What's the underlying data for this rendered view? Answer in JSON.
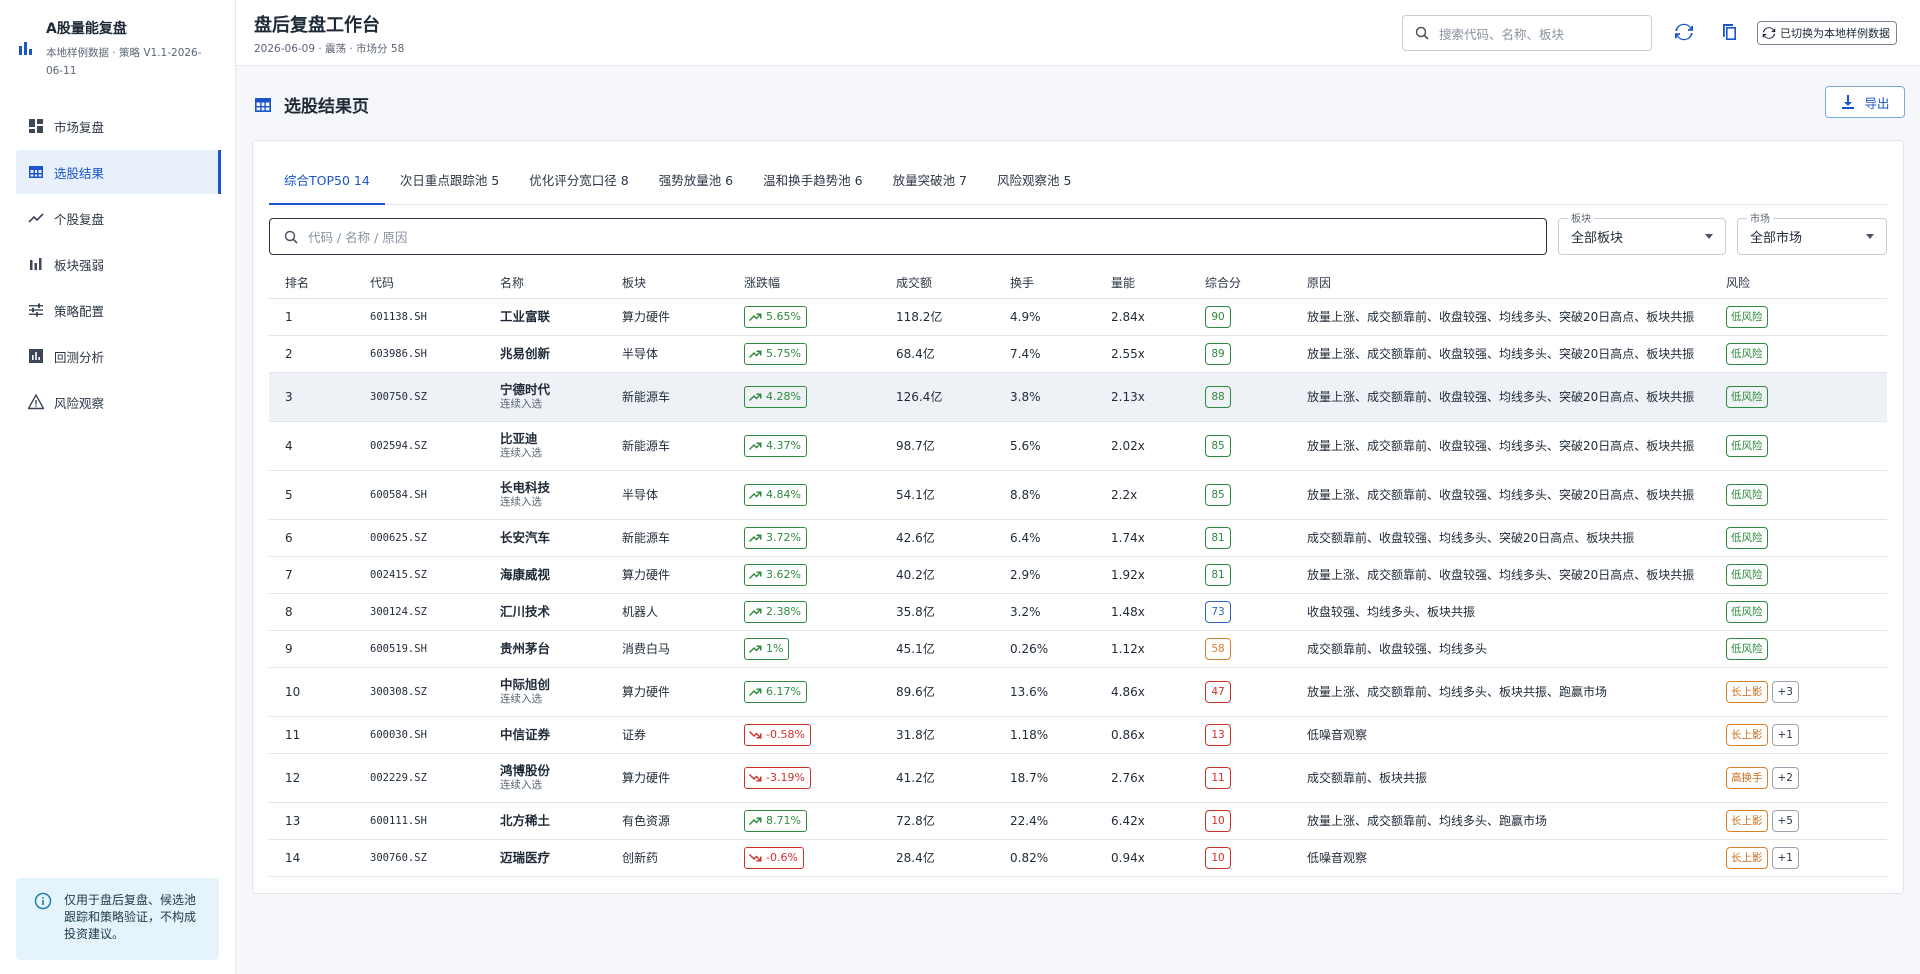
{
  "brand": {
    "title": "A股量能复盘",
    "subtitle": "本地样例数据 · 策略 V1.1-2026-06-11"
  },
  "sidebar": {
    "items": [
      {
        "label": "市场复盘",
        "icon": "dashboard-icon"
      },
      {
        "label": "选股结果",
        "icon": "table-icon",
        "active": true
      },
      {
        "label": "个股复盘",
        "icon": "trend-icon"
      },
      {
        "label": "板块强弱",
        "icon": "bar-chart-icon"
      },
      {
        "label": "策略配置",
        "icon": "sliders-icon"
      },
      {
        "label": "回测分析",
        "icon": "analytics-icon"
      },
      {
        "label": "风险观察",
        "icon": "warning-icon"
      }
    ],
    "notice": "仅用于盘后复盘、候选池跟踪和策略验证，不构成投资建议。"
  },
  "header": {
    "title": "盘后复盘工作台",
    "subtitle": "2026-06-09 · 震荡 · 市场分 58",
    "search_placeholder": "搜索代码、名称、板块",
    "switch_label": "已切换为本地样例数据"
  },
  "page": {
    "title": "选股结果页",
    "export_label": "导出"
  },
  "tabs": [
    "综合TOP50 14",
    "次日重点跟踪池 5",
    "优化评分宽口径 8",
    "强势放量池 6",
    "温和换手趋势池 6",
    "放量突破池 7",
    "风险观察池 5"
  ],
  "filters": {
    "search_placeholder": "代码 / 名称 / 原因",
    "sector_label": "板块",
    "sector_value": "全部板块",
    "market_label": "市场",
    "market_value": "全部市场"
  },
  "table": {
    "columns": [
      "排名",
      "代码",
      "名称",
      "板块",
      "涨跌幅",
      "成交额",
      "换手",
      "量能",
      "综合分",
      "原因",
      "风险"
    ],
    "rows": [
      {
        "rank": "1",
        "code": "601138.SH",
        "name": "工业富联",
        "note": "",
        "sector": "算力硬件",
        "chg": "5.65%",
        "dir": "up",
        "amount": "118.2亿",
        "turnover": "4.9%",
        "vol": "2.84x",
        "score": "90",
        "sc": "g",
        "reason": "放量上涨、成交额靠前、收盘较强、均线多头、突破20日高点、板块共振",
        "risk": "低风险",
        "rk": "low",
        "more": ""
      },
      {
        "rank": "2",
        "code": "603986.SH",
        "name": "兆易创新",
        "note": "",
        "sector": "半导体",
        "chg": "5.75%",
        "dir": "up",
        "amount": "68.4亿",
        "turnover": "7.4%",
        "vol": "2.55x",
        "score": "89",
        "sc": "g",
        "reason": "放量上涨、成交额靠前、收盘较强、均线多头、突破20日高点、板块共振",
        "risk": "低风险",
        "rk": "low",
        "more": ""
      },
      {
        "rank": "3",
        "code": "300750.SZ",
        "name": "宁德时代",
        "note": "连续入选",
        "sector": "新能源车",
        "chg": "4.28%",
        "dir": "up",
        "amount": "126.4亿",
        "turnover": "3.8%",
        "vol": "2.13x",
        "score": "88",
        "sc": "g",
        "reason": "放量上涨、成交额靠前、收盘较强、均线多头、突破20日高点、板块共振",
        "risk": "低风险",
        "rk": "low",
        "more": "",
        "selected": true
      },
      {
        "rank": "4",
        "code": "002594.SZ",
        "name": "比亚迪",
        "note": "连续入选",
        "sector": "新能源车",
        "chg": "4.37%",
        "dir": "up",
        "amount": "98.7亿",
        "turnover": "5.6%",
        "vol": "2.02x",
        "score": "85",
        "sc": "g",
        "reason": "放量上涨、成交额靠前、收盘较强、均线多头、突破20日高点、板块共振",
        "risk": "低风险",
        "rk": "low",
        "more": ""
      },
      {
        "rank": "5",
        "code": "600584.SH",
        "name": "长电科技",
        "note": "连续入选",
        "sector": "半导体",
        "chg": "4.84%",
        "dir": "up",
        "amount": "54.1亿",
        "turnover": "8.8%",
        "vol": "2.2x",
        "score": "85",
        "sc": "g",
        "reason": "放量上涨、成交额靠前、收盘较强、均线多头、突破20日高点、板块共振",
        "risk": "低风险",
        "rk": "low",
        "more": ""
      },
      {
        "rank": "6",
        "code": "000625.SZ",
        "name": "长安汽车",
        "note": "",
        "sector": "新能源车",
        "chg": "3.72%",
        "dir": "up",
        "amount": "42.6亿",
        "turnover": "6.4%",
        "vol": "1.74x",
        "score": "81",
        "sc": "g",
        "reason": "成交额靠前、收盘较强、均线多头、突破20日高点、板块共振",
        "risk": "低风险",
        "rk": "low",
        "more": ""
      },
      {
        "rank": "7",
        "code": "002415.SZ",
        "name": "海康威视",
        "note": "",
        "sector": "算力硬件",
        "chg": "3.62%",
        "dir": "up",
        "amount": "40.2亿",
        "turnover": "2.9%",
        "vol": "1.92x",
        "score": "81",
        "sc": "g",
        "reason": "放量上涨、成交额靠前、收盘较强、均线多头、突破20日高点、板块共振",
        "risk": "低风险",
        "rk": "low",
        "more": ""
      },
      {
        "rank": "8",
        "code": "300124.SZ",
        "name": "汇川技术",
        "note": "",
        "sector": "机器人",
        "chg": "2.38%",
        "dir": "up",
        "amount": "35.8亿",
        "turnover": "3.2%",
        "vol": "1.48x",
        "score": "73",
        "sc": "b",
        "reason": "收盘较强、均线多头、板块共振",
        "risk": "低风险",
        "rk": "low",
        "more": ""
      },
      {
        "rank": "9",
        "code": "600519.SH",
        "name": "贵州茅台",
        "note": "",
        "sector": "消费白马",
        "chg": "1%",
        "dir": "up",
        "amount": "45.1亿",
        "turnover": "0.26%",
        "vol": "1.12x",
        "score": "58",
        "sc": "o",
        "reason": "成交额靠前、收盘较强、均线多头",
        "risk": "低风险",
        "rk": "low",
        "more": ""
      },
      {
        "rank": "10",
        "code": "300308.SZ",
        "name": "中际旭创",
        "note": "连续入选",
        "sector": "算力硬件",
        "chg": "6.17%",
        "dir": "up",
        "amount": "89.6亿",
        "turnover": "13.6%",
        "vol": "4.86x",
        "score": "47",
        "sc": "r",
        "reason": "放量上涨、成交额靠前、均线多头、板块共振、跑赢市场",
        "risk": "长上影",
        "rk": "warn",
        "more": "+3"
      },
      {
        "rank": "11",
        "code": "600030.SH",
        "name": "中信证券",
        "note": "",
        "sector": "证券",
        "chg": "-0.58%",
        "dir": "dn",
        "amount": "31.8亿",
        "turnover": "1.18%",
        "vol": "0.86x",
        "score": "13",
        "sc": "r",
        "reason": "低噪音观察",
        "risk": "长上影",
        "rk": "warn",
        "more": "+1"
      },
      {
        "rank": "12",
        "code": "002229.SZ",
        "name": "鸿博股份",
        "note": "连续入选",
        "sector": "算力硬件",
        "chg": "-3.19%",
        "dir": "dn",
        "amount": "41.2亿",
        "turnover": "18.7%",
        "vol": "2.76x",
        "score": "11",
        "sc": "r",
        "reason": "成交额靠前、板块共振",
        "risk": "高换手",
        "rk": "warn",
        "more": "+2"
      },
      {
        "rank": "13",
        "code": "600111.SH",
        "name": "北方稀土",
        "note": "",
        "sector": "有色资源",
        "chg": "8.71%",
        "dir": "up",
        "amount": "72.8亿",
        "turnover": "22.4%",
        "vol": "6.42x",
        "score": "10",
        "sc": "r",
        "reason": "放量上涨、成交额靠前、均线多头、跑赢市场",
        "risk": "长上影",
        "rk": "warn",
        "more": "+5"
      },
      {
        "rank": "14",
        "code": "300760.SZ",
        "name": "迈瑞医疗",
        "note": "",
        "sector": "创新药",
        "chg": "-0.6%",
        "dir": "dn",
        "amount": "28.4亿",
        "turnover": "0.82%",
        "vol": "0.94x",
        "score": "10",
        "sc": "r",
        "reason": "低噪音观察",
        "risk": "长上影",
        "rk": "warn",
        "more": "+1"
      }
    ]
  },
  "colors": {
    "accent": "#1a56c9",
    "up": "#2e8a3e",
    "down": "#d0302a",
    "warn": "#d9822b"
  }
}
